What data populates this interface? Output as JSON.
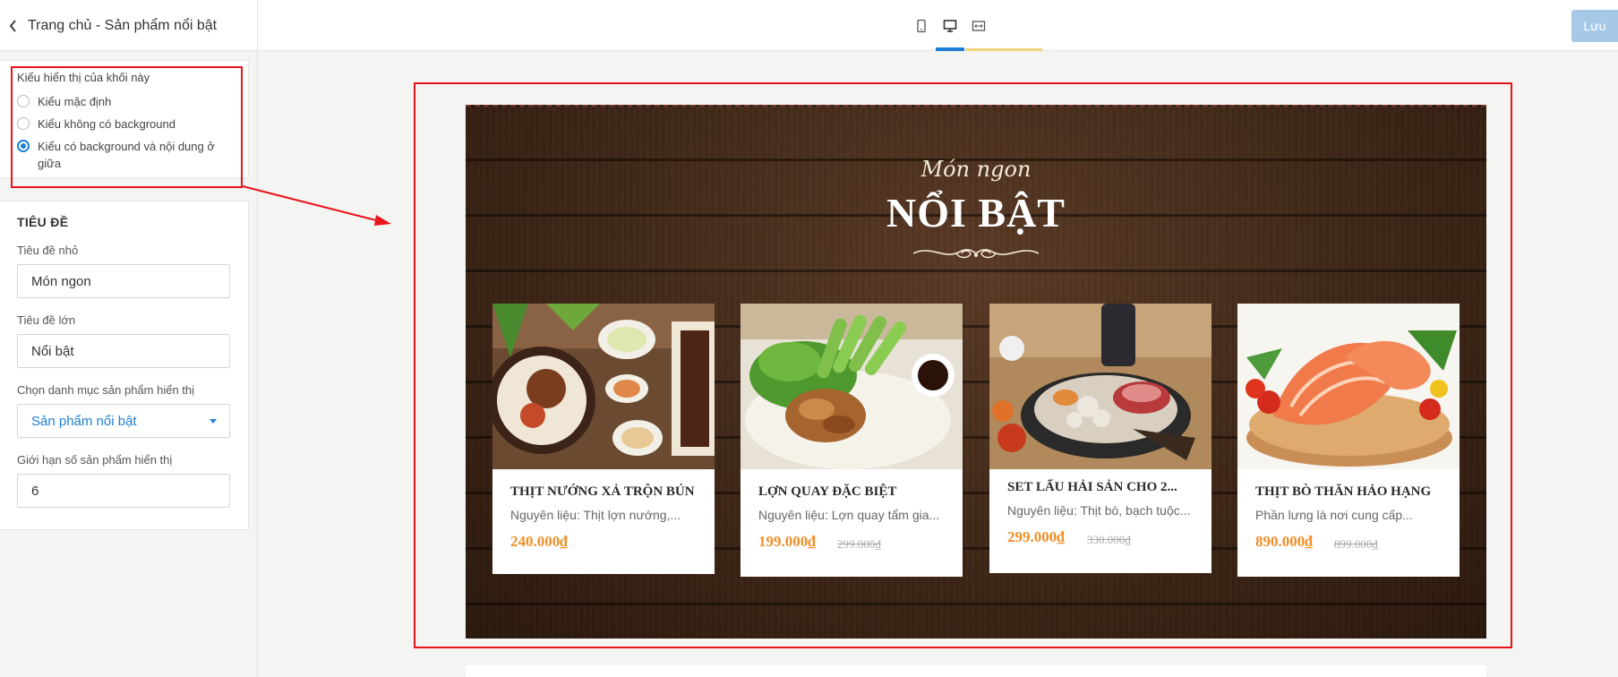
{
  "header": {
    "title": "Trang chủ - Sản phẩm nổi bật",
    "devices": [
      "mobile-icon",
      "desktop-icon",
      "fullwidth-icon"
    ],
    "save_label": "Lưu"
  },
  "display": {
    "heading": "Kiểu hiển thị của khối này",
    "options": [
      {
        "label": "Kiểu mặc định",
        "checked": false
      },
      {
        "label": "Kiểu không có background",
        "checked": false
      },
      {
        "label": "Kiểu có background và nội dung ở giữa",
        "checked": true
      }
    ]
  },
  "settings": {
    "section_title": "TIÊU ĐỀ",
    "small_title_label": "Tiêu đề nhỏ",
    "small_title_value": "Món ngon",
    "big_title_label": "Tiêu đề lớn",
    "big_title_value": "Nổi bật",
    "category_label": "Chọn danh mục sản phẩm hiển thị",
    "category_value": "Sản phẩm nổi bật",
    "limit_label": "Giới hạn số sản phẩm hiển thị",
    "limit_value": "6"
  },
  "preview": {
    "subtitle": "Món ngon",
    "title": "NỔI BẬT",
    "products": [
      {
        "name": "THỊT NƯỚNG XẢ TRỘN BÚN",
        "desc": "Nguyên liệu: Thịt lợn nướng,...",
        "price": "240.000₫",
        "old_price": ""
      },
      {
        "name": "LỢN QUAY ĐẶC BIỆT",
        "desc": "Nguyên liệu: Lợn quay tẩm gia...",
        "price": "199.000₫",
        "old_price": "299.000₫"
      },
      {
        "name": "SET LẨU HẢI SẢN CHO 2...",
        "desc": "Nguyên liệu: Thịt bò, bạch tuộc...",
        "price": "299.000₫",
        "old_price": "330.000₫"
      },
      {
        "name": "THỊT BÒ THĂN HẢO HẠNG",
        "desc": "Phần lưng là nơi cung cấp...",
        "price": "890.000₫",
        "old_price": "899.000₫"
      }
    ]
  },
  "colors": {
    "accent": "#1f7fd6",
    "highlight": "#e8141c",
    "price": "#f0902a",
    "save_button": "#a7c9e8"
  }
}
